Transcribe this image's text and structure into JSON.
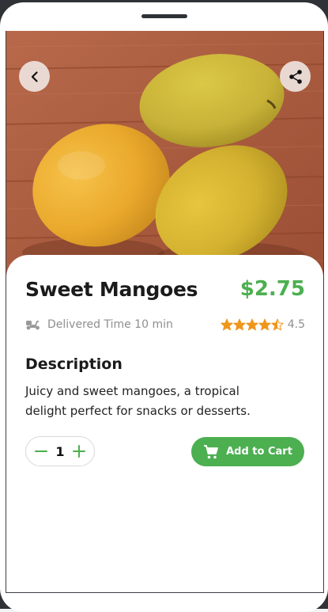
{
  "product": {
    "name": "Sweet Mangoes",
    "price": "$2.75",
    "delivery_text": "Delivered Time 10 min",
    "rating_value": "4.5",
    "rating": 4.5,
    "rating_max": 5
  },
  "description": {
    "heading": "Description",
    "text": "Juicy and sweet mangoes, a tropical delight perfect for snacks or desserts."
  },
  "quantity": {
    "value": "1"
  },
  "actions": {
    "add_to_cart_label": "Add to Cart"
  },
  "icons": {
    "back": "chevron-left-icon",
    "share": "share-icon",
    "delivery": "scooter-icon",
    "star": "star-icon",
    "minus": "minus-icon",
    "plus": "plus-icon",
    "cart": "cart-icon"
  },
  "colors": {
    "accent": "#4caf50",
    "star": "#f0961b",
    "muted_text": "#8f8f8f"
  }
}
